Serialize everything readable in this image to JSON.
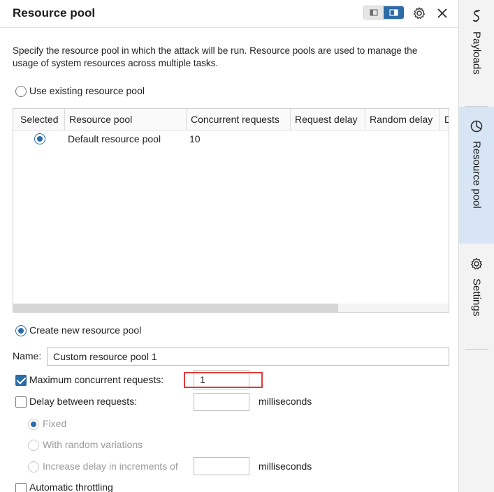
{
  "panel": {
    "title": "Resource pool",
    "description": "Specify the resource pool in which the attack will be run. Resource pools are used to manage the usage of system resources across multiple tasks."
  },
  "options": {
    "use_existing_label": "Use existing resource pool",
    "create_new_label": "Create new resource pool"
  },
  "table": {
    "columns": [
      "Selected",
      "Resource pool",
      "Concurrent requests",
      "Request delay",
      "Random delay",
      "D"
    ],
    "rows": [
      {
        "pool": "Default resource pool",
        "concurrent": "10",
        "request_delay": "",
        "random_delay": ""
      }
    ]
  },
  "form": {
    "name_label": "Name:",
    "name_value": "Custom resource pool 1",
    "max_concurrent_label": "Maximum concurrent requests:",
    "max_concurrent_value": "1",
    "delay_label": "Delay between requests:",
    "delay_value": "",
    "ms_label": "milliseconds",
    "fixed_label": "Fixed",
    "random_variations_label": "With random variations",
    "increase_label": "Increase delay in increments of",
    "increase_value": "",
    "auto_throttle_label": "Automatic throttling"
  },
  "rail": {
    "tabs": [
      {
        "label": "Payloads"
      },
      {
        "label": "Resource pool"
      },
      {
        "label": "Settings"
      }
    ]
  },
  "colors": {
    "accent": "#2c6ca7",
    "highlight": "#e03a3a",
    "rail_active": "#d7e5f4"
  }
}
